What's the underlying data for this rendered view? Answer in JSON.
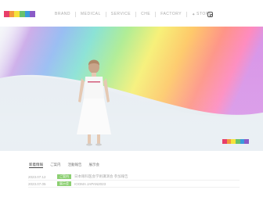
{
  "header": {
    "logo_colors": [
      "#e83e6a",
      "#f39a3c",
      "#f5e23a",
      "#69c26b",
      "#3a9bdc",
      "#8a5bc7"
    ],
    "nav": [
      {
        "label": "BRAND"
      },
      {
        "label": "MEDICAL"
      },
      {
        "label": "SERVICE"
      },
      {
        "label": "CHE"
      },
      {
        "label": "FACTORY"
      },
      {
        "label": "STORE"
      }
    ]
  },
  "hero": {
    "brand_mark_colors": [
      "#e83e6a",
      "#f39a3c",
      "#f5e23a",
      "#69c26b",
      "#3a9bdc",
      "#8a5bc7"
    ]
  },
  "tabs": [
    {
      "label": "新着情報"
    },
    {
      "label": "ご案内"
    },
    {
      "label": "活動報告"
    },
    {
      "label": "展示会"
    }
  ],
  "news": [
    {
      "date": "2023.07.12",
      "tag": "ご案内",
      "text": "日本眼科医会学術講演会 参加報告"
    },
    {
      "date": "2023.07.05",
      "tag": "展示会",
      "text": "IOOMA JAPAN2023"
    }
  ]
}
